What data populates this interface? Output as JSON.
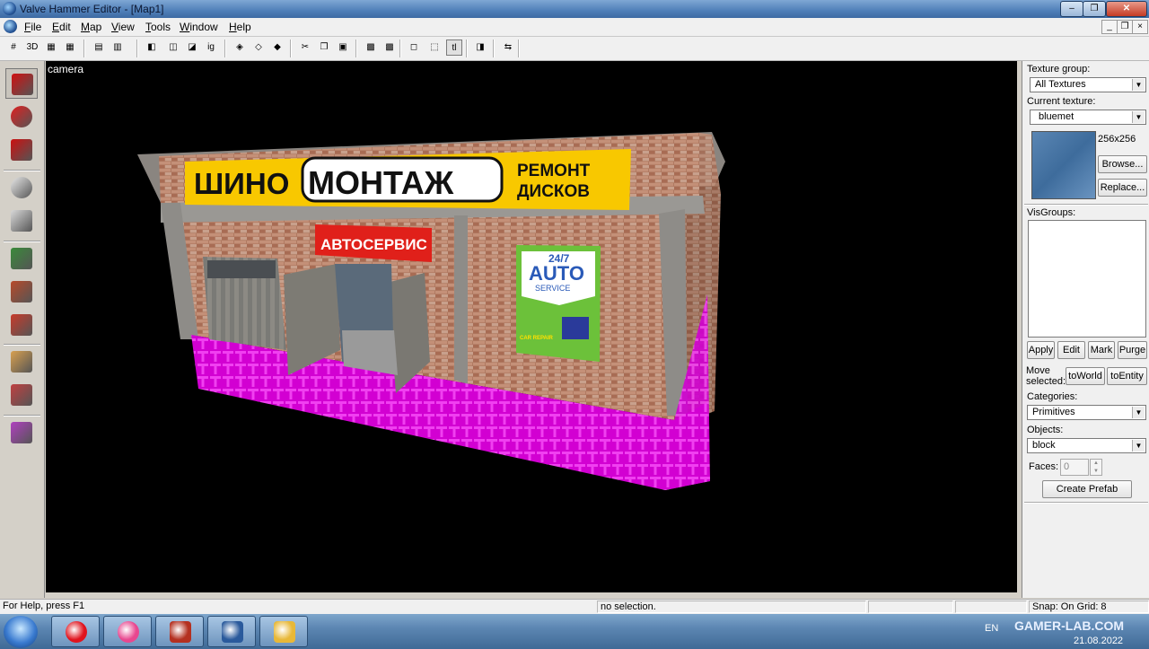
{
  "window": {
    "title": "Valve Hammer Editor - [Map1]",
    "controls": {
      "minimize": "–",
      "maximize": "❐",
      "close": "✕"
    }
  },
  "menu": [
    "File",
    "Edit",
    "Map",
    "View",
    "Tools",
    "Window",
    "Help"
  ],
  "mdi_controls": {
    "minimize": "_",
    "restore": "❐",
    "close": "×"
  },
  "toolbar": [
    {
      "name": "grid-icon",
      "glyph": "#"
    },
    {
      "name": "3d-grid-icon",
      "glyph": "3D"
    },
    {
      "name": "smaller-grid-icon",
      "glyph": "▦"
    },
    {
      "name": "larger-grid-icon",
      "glyph": "▦"
    },
    {
      "name": "load-window-state-icon",
      "glyph": "▤"
    },
    {
      "name": "save-window-state-icon",
      "glyph": "▥"
    },
    {
      "name": "carve-icon",
      "glyph": "◧"
    },
    {
      "name": "group-icon",
      "glyph": "◫"
    },
    {
      "name": "ungroup-icon",
      "glyph": "◪"
    },
    {
      "name": "ignore-grouping-icon",
      "glyph": "ig"
    },
    {
      "name": "hide-selected-icon",
      "glyph": "◈"
    },
    {
      "name": "hide-unselected-icon",
      "glyph": "◇"
    },
    {
      "name": "show-all-icon",
      "glyph": "◆"
    },
    {
      "name": "cut-icon",
      "glyph": "✂"
    },
    {
      "name": "copy-icon",
      "glyph": "❐"
    },
    {
      "name": "paste-icon",
      "glyph": "▣"
    },
    {
      "name": "texture-lock-icon",
      "glyph": "▩"
    },
    {
      "name": "texture-scale-lock-icon",
      "glyph": "▩"
    },
    {
      "name": "selection-box-icon",
      "glyph": "◻"
    },
    {
      "name": "select-by-handles-icon",
      "glyph": "⬚"
    },
    {
      "name": "toggle-select-icon",
      "glyph": "tl"
    },
    {
      "name": "run-map-icon",
      "glyph": "◨"
    },
    {
      "name": "entity-report-icon",
      "glyph": "⇆"
    }
  ],
  "tools": [
    {
      "name": "selection-tool-icon",
      "color": "#d01010",
      "pressed": true
    },
    {
      "name": "magnify-tool-icon",
      "color": "#e02020",
      "pressed": false
    },
    {
      "name": "camera-tool-icon",
      "color": "#cc1010",
      "pressed": false
    },
    {
      "name": "entity-tool-icon",
      "color": "#e8e8e8",
      "pressed": false
    },
    {
      "name": "block-tool-icon",
      "color": "#d8d8d8",
      "pressed": false
    },
    {
      "name": "texture-application-icon",
      "color": "#3a8a3a",
      "pressed": false
    },
    {
      "name": "apply-current-texture-icon",
      "color": "#b84a2a",
      "pressed": false
    },
    {
      "name": "decal-tool-icon",
      "color": "#c83a2a",
      "pressed": false
    },
    {
      "name": "clipping-tool-icon",
      "color": "#d8a050",
      "pressed": false
    },
    {
      "name": "vertex-manipulation-icon",
      "color": "#c04040",
      "pressed": false
    },
    {
      "name": "path-tool-icon",
      "color": "#b040c0",
      "pressed": false
    }
  ],
  "viewport": {
    "label": "camera"
  },
  "scene": {
    "sign_main_left": "ШИНО",
    "sign_main_box": "МОНТАЖ",
    "sign_right_top": "РЕМОНТ",
    "sign_right_bottom": "ДИСКОВ",
    "sign_red": "АВТОСЕРВИС",
    "poster_top": "24/7",
    "poster_mid": "AUTO",
    "poster_sub": "SERVICE",
    "poster_bottom": "CAR REPAIR"
  },
  "panel": {
    "texture_group_label": "Texture group:",
    "texture_group_value": "All Textures",
    "current_texture_label": "Current texture:",
    "current_texture_value": "bluemet",
    "texture_size": "256x256",
    "browse_label": "Browse...",
    "replace_label": "Replace...",
    "visgroups_label": "VisGroups:",
    "apply_label": "Apply",
    "edit_label": "Edit",
    "mark_label": "Mark",
    "purge_label": "Purge",
    "move_selected_label_1": "Move",
    "move_selected_label_2": "selected:",
    "to_world_label": "toWorld",
    "to_entity_label": "toEntity",
    "categories_label": "Categories:",
    "categories_value": "Primitives",
    "objects_label": "Objects:",
    "objects_value": "block",
    "faces_label": "Faces:",
    "faces_value": "0",
    "create_prefab_label": "Create Prefab"
  },
  "status": {
    "help": "For Help, press F1",
    "selection": "no selection.",
    "snap": "Snap: On Grid: 8"
  },
  "taskbar": {
    "items": [
      {
        "name": "opera-browser-icon",
        "color": "#e0141e"
      },
      {
        "name": "opera-gx-icon",
        "color": "#e8478f"
      },
      {
        "name": "app-icon-red",
        "color": "#b43020"
      },
      {
        "name": "hammer-editor-icon",
        "color": "#2a5a9c"
      },
      {
        "name": "file-explorer-icon",
        "color": "#e8b838"
      }
    ],
    "language": "EN",
    "date": "21.08.2022",
    "watermark": "GAMER-LAB.COM"
  }
}
